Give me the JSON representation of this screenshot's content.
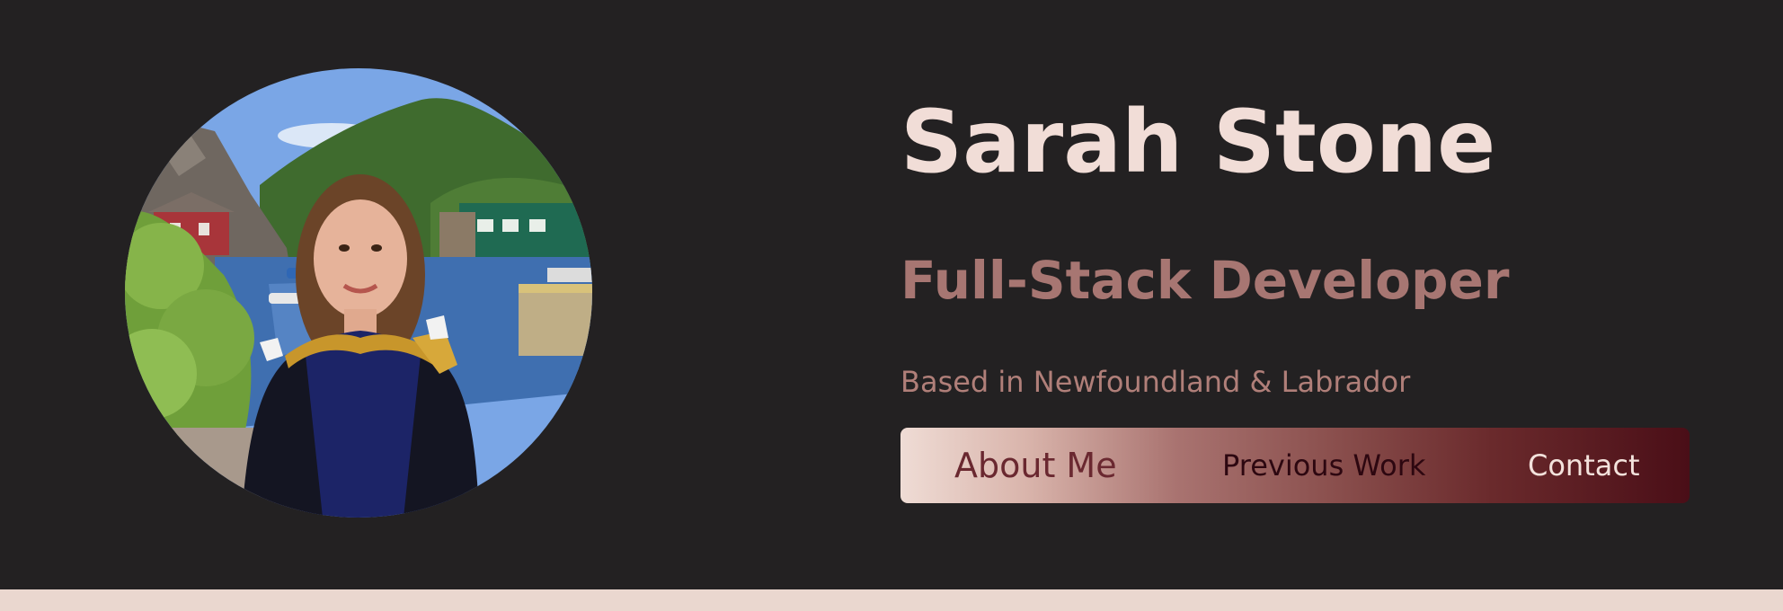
{
  "profile": {
    "name": "Sarah Stone",
    "role": "Full-Stack Developer",
    "location": "Based in Newfoundland & Labrador",
    "photo": "portrait-photo"
  },
  "nav": {
    "items": [
      {
        "label": "About Me"
      },
      {
        "label": "Previous Work"
      },
      {
        "label": "Contact"
      }
    ]
  },
  "colors": {
    "background": "#232122",
    "name": "#f1ddd7",
    "role": "#a77672",
    "location": "#b07f79",
    "strip": "#ead7cf",
    "nav_gradient_start": "#efdcd5",
    "nav_gradient_end": "#4a0e17"
  }
}
